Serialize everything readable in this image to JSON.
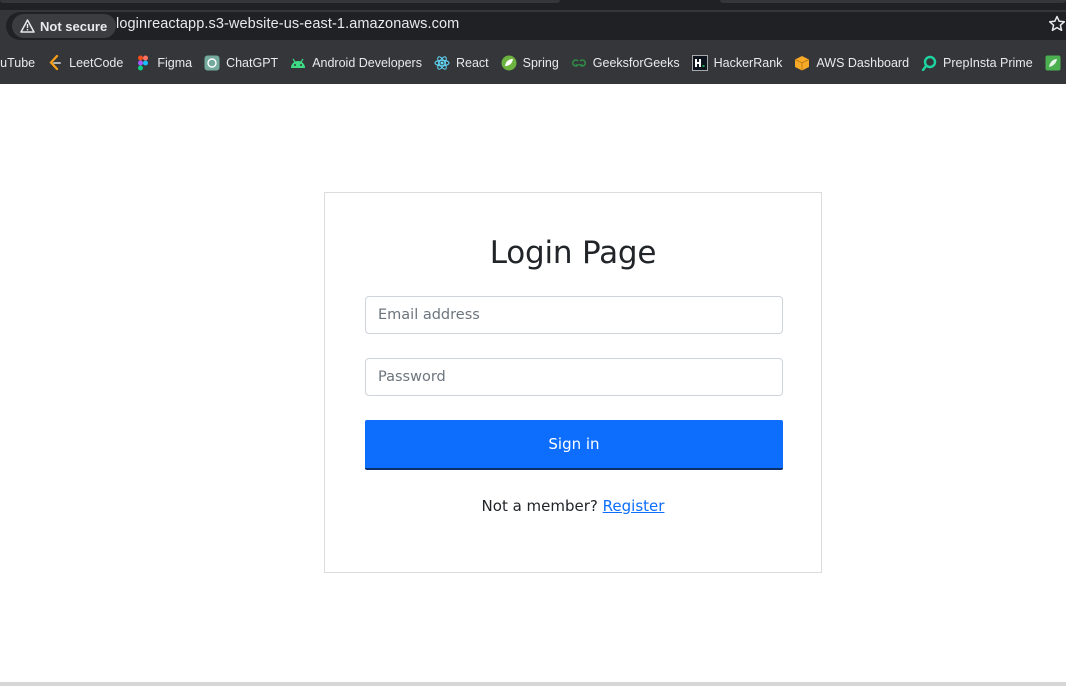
{
  "browser": {
    "security_label": "Not secure",
    "url": "loginreactapp.s3-website-us-east-1.amazonaws.com",
    "bookmarks": [
      {
        "label": "YouTube",
        "icon": "youtube-icon"
      },
      {
        "label": "LeetCode",
        "icon": "leetcode-icon"
      },
      {
        "label": "Figma",
        "icon": "figma-icon"
      },
      {
        "label": "ChatGPT",
        "icon": "chatgpt-icon"
      },
      {
        "label": "Android Developers",
        "icon": "android-icon"
      },
      {
        "label": "React",
        "icon": "react-icon"
      },
      {
        "label": "Spring",
        "icon": "spring-icon"
      },
      {
        "label": "GeeksforGeeks",
        "icon": "geeksforgeeks-icon"
      },
      {
        "label": "HackerRank",
        "icon": "hackerrank-icon"
      },
      {
        "label": "AWS Dashboard",
        "icon": "aws-icon"
      },
      {
        "label": "PrepInsta Prime",
        "icon": "prepinsta-icon"
      }
    ]
  },
  "login": {
    "title": "Login Page",
    "email_placeholder": "Email address",
    "email_value": "",
    "password_placeholder": "Password",
    "password_value": "",
    "signin_label": "Sign in",
    "footer_text": "Not a member?",
    "register_label": "Register"
  },
  "colors": {
    "primary": "#0d6efd",
    "chrome_bg": "#35363a",
    "omnibox_bg": "#202124"
  }
}
